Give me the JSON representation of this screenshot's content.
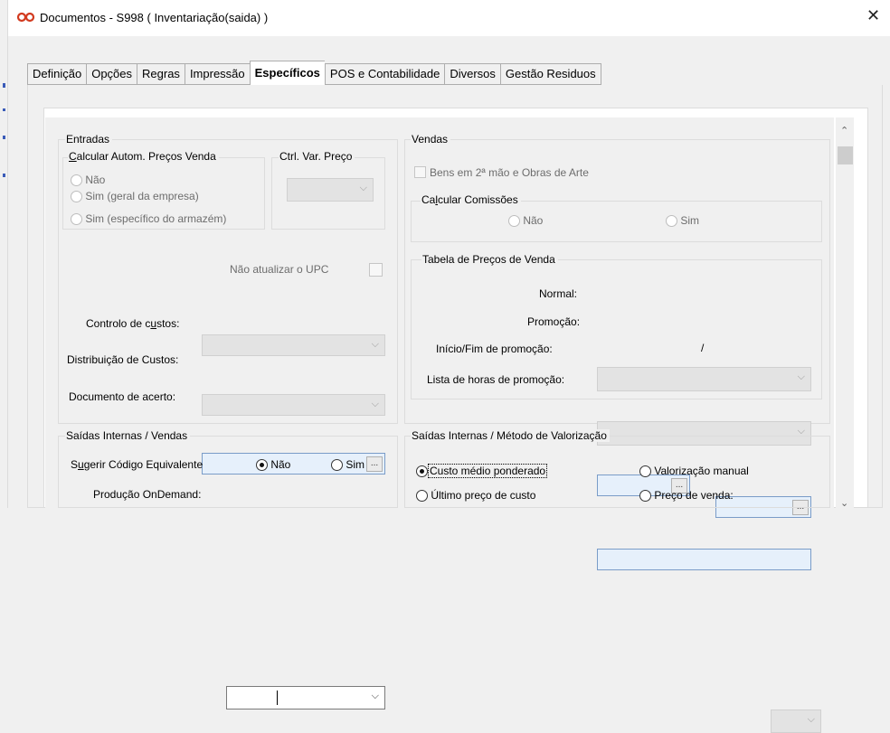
{
  "window": {
    "title": "Documentos - S998 ( Inventariação(saida) )",
    "close_glyph": "✕"
  },
  "tabs": [
    {
      "label": "Definição"
    },
    {
      "label": "Opções"
    },
    {
      "label": "Regras"
    },
    {
      "label": "Impressão"
    },
    {
      "label": "Específicos"
    },
    {
      "label": "POS e Contabilidade"
    },
    {
      "label": "Diversos"
    },
    {
      "label": "Gestão Residuos"
    }
  ],
  "active_tab": "Específicos",
  "entradas": {
    "title": "Entradas",
    "calc_title_u": "C",
    "calc_title_rest": "alcular Autom. Preços Venda",
    "options": [
      "Não",
      "Sim (geral da empresa)",
      "Sim (específico do armazém)"
    ],
    "ctrl_var_title": "Ctrl. Var. Preço",
    "nao_atualizar": "Não atualizar o UPC",
    "controlo_a": "Controlo de c",
    "controlo_u": "u",
    "controlo_b": "stos:",
    "distribuicao": "Distribuição de Custos:",
    "documento_acerto": "Documento de acerto:",
    "ellipsis": "..."
  },
  "vendas": {
    "title": "Vendas",
    "bens": "Bens em 2ª mão e Obras de Arte",
    "comissoes_a": "Ca",
    "comissoes_u": "l",
    "comissoes_b": "cular Comissões",
    "comissoes_options": [
      "Não",
      "Sim"
    ],
    "tabela_title": "Tabela de Preços de Venda",
    "normal": "Normal:",
    "promocao": "Promoção:",
    "inicio_fim": "Início/Fim de promoção:",
    "slash": "/",
    "lista_horas": "Lista de horas de promoção:"
  },
  "saidas_vendas": {
    "title": "Saídas Internas / Vendas",
    "sugerir_a": "S",
    "sugerir_u": "u",
    "sugerir_b": "gerir Código Equivalente",
    "options": [
      "Não",
      "Sim"
    ],
    "selected": "Não",
    "producao": "Produção OnDemand:"
  },
  "saidas_valorizacao": {
    "title": "Saídas Internas / Método de  Valorização",
    "options": [
      "Custo médio ponderado",
      "Último preço de custo",
      "Valorização manual",
      "Preço de venda:"
    ],
    "selected": "Custo médio ponderado"
  }
}
